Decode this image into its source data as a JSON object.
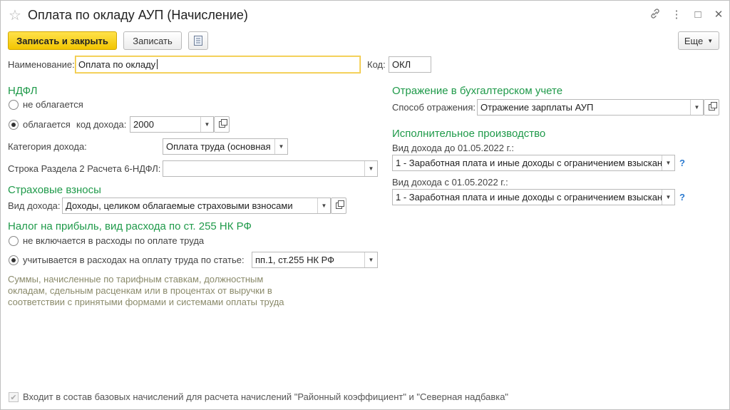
{
  "window": {
    "title": "Оплата по окладу АУП (Начисление)",
    "controls": {
      "link": "⛓",
      "more": "⋮",
      "minimize": "□",
      "close": "✕"
    }
  },
  "toolbar": {
    "save_close_label": "Записать и закрыть",
    "save_label": "Записать",
    "more_label": "Еще"
  },
  "main": {
    "name_label": "Наименование:",
    "name_value": "Оплата по окладу",
    "code_label": "Код:",
    "code_value": "ОКЛ"
  },
  "ndfl": {
    "heading": "НДФЛ",
    "option_not_taxed": "не облагается",
    "option_taxed": "облагается",
    "selected": "taxed",
    "income_code_label": "код дохода:",
    "income_code_value": "2000",
    "income_category_label": "Категория дохода:",
    "income_category_value": "Оплата труда (основная",
    "row_6ndfl_label": "Строка Раздела 2 Расчета 6-НДФЛ:",
    "row_6ndfl_value": ""
  },
  "insurance": {
    "heading": "Страховые взносы",
    "income_type_label": "Вид дохода:",
    "income_type_value": "Доходы, целиком облагаемые страховыми взносами"
  },
  "profit_tax": {
    "heading": "Налог на прибыль, вид расхода по ст. 255 НК РФ",
    "option_not_included": "не включается в расходы по оплате труда",
    "option_included": "учитывается в расходах на оплату труда по статье:",
    "selected": "included",
    "article_value": "пп.1, ст.255 НК РФ",
    "hint": "Суммы, начисленные по тарифным ставкам, должностным окладам, сдельным расценкам или в процентах от выручки в соответствии с принятыми формами и системами оплаты труда"
  },
  "accounting": {
    "heading": "Отражение в бухгалтерском учете",
    "method_label": "Способ отражения:",
    "method_value": "Отражение зарплаты АУП"
  },
  "enforcement": {
    "heading": "Исполнительное производство",
    "before_label": "Вид дохода до 01.05.2022 г.:",
    "before_value": "1 - Заработная плата и иные доходы с ограничением взыскан",
    "after_label": "Вид дохода с 01.05.2022 г.:",
    "after_value": "1 - Заработная плата и иные доходы с ограничением взыскан",
    "help": "?"
  },
  "footer": {
    "base_accruals_label": "Входит в состав базовых начислений для расчета начислений \"Районный коэффициент\" и \"Северная надбавка\"",
    "base_accruals_checked": true
  }
}
